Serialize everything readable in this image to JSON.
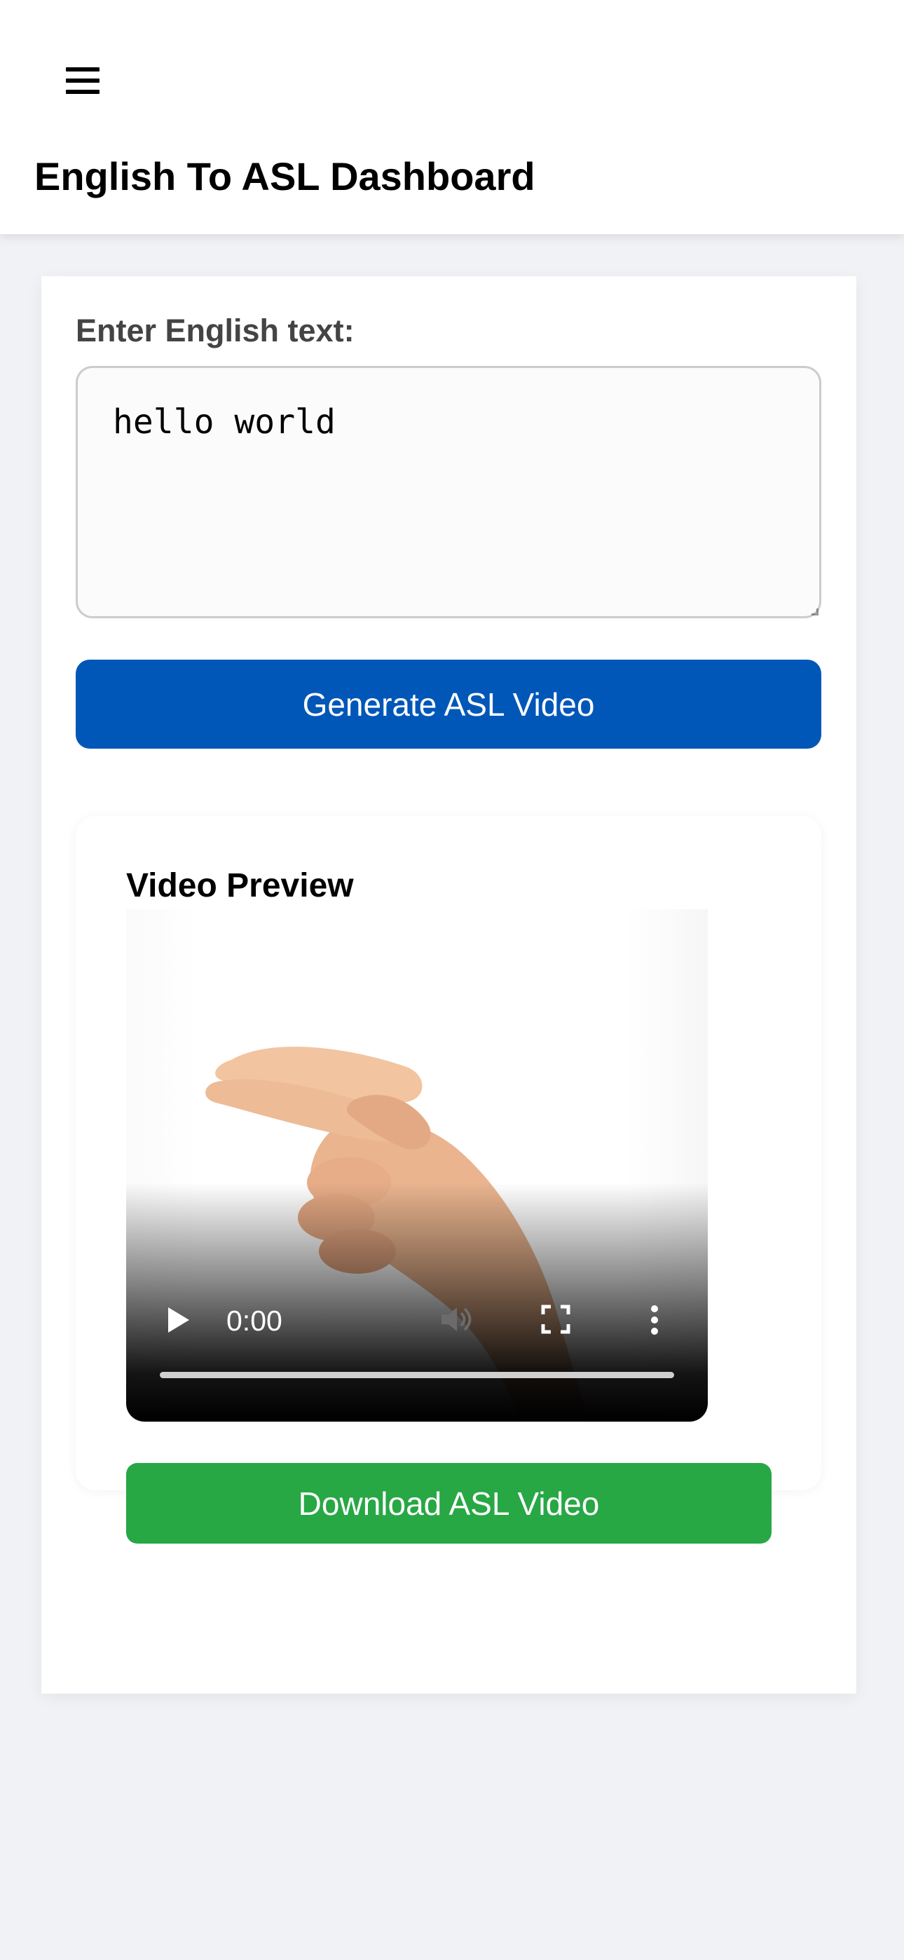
{
  "header": {
    "menu_icon": "hamburger-menu-icon",
    "title": "English To ASL Dashboard"
  },
  "input": {
    "label": "Enter English text:",
    "value": "hello world"
  },
  "actions": {
    "generate_label": "Generate ASL Video",
    "download_label": "Download ASL Video"
  },
  "preview": {
    "title": "Video Preview",
    "video": {
      "current_time": "0:00",
      "progress": 0,
      "controls": [
        "play-icon",
        "volume-muted-icon",
        "fullscreen-icon",
        "more-options-icon"
      ]
    }
  },
  "colors": {
    "primary_button": "#0057b8",
    "download_button": "#28a745",
    "page_background": "#f0f2f6",
    "card_background": "#ffffff",
    "label_text": "#444444"
  }
}
